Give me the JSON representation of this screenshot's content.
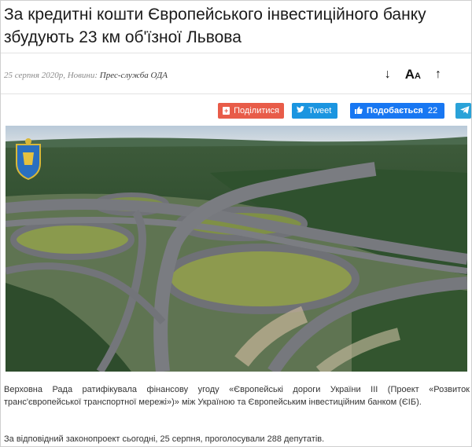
{
  "article": {
    "title": "За кредитні кошти Європейського інвестиційного банку збудують 23 км об'їзної Львова",
    "meta_date": "25 серпня 2020р, Новини:",
    "meta_source": "Прес-служба ОДА",
    "paragraph_1": "Верховна Рада ратифікувала фінансову угоду «Європейські дороги України ІІІ (Проект «Розвиток транс'європейської транспортної мережі»)» між Україною та Європейським інвестиційним банком (ЄІБ).",
    "paragraph_2": "За відповідний законопроект сьогодні, 25 серпня, проголосували 288 депутатів."
  },
  "tools": {
    "download_icon": "↓",
    "font_icon": "A",
    "up_icon": "↑"
  },
  "share": {
    "share_label": "Поділитися",
    "tweet_label": "Tweet",
    "like_label": "Подобається",
    "like_count": "22"
  },
  "icons": [
    "download-arrow-icon",
    "font-size-icon",
    "scroll-up-icon",
    "plus-icon",
    "twitter-bird-icon",
    "thumbs-up-icon",
    "telegram-plane-icon",
    "coat-of-arms-logo"
  ],
  "colors": {
    "share": "#e85c49",
    "tweet": "#1b95e0",
    "like": "#1877f2",
    "telegram": "#2aa2d8"
  }
}
